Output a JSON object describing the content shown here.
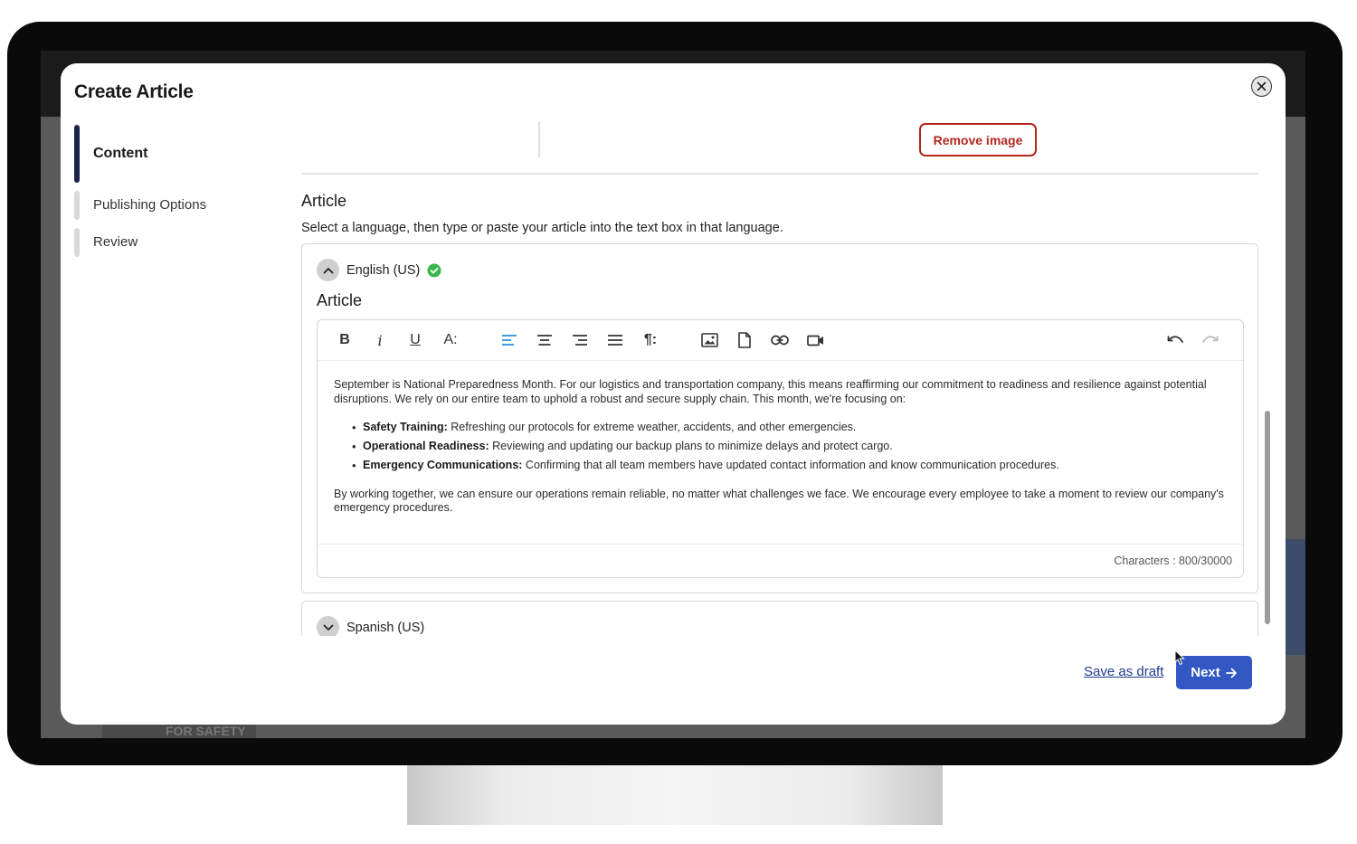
{
  "modal": {
    "title": "Create Article",
    "close_label": "×"
  },
  "stepper": {
    "items": [
      {
        "label": "Content",
        "active": true
      },
      {
        "label": "Publishing Options",
        "active": false
      },
      {
        "label": "Review",
        "active": false
      }
    ]
  },
  "image_section": {
    "remove_image_label": "Remove image"
  },
  "article_section": {
    "title": "Article",
    "subtitle": "Select a language, then type or paste your article into the text box in that language."
  },
  "languages": [
    {
      "label": "English (US)",
      "expanded": true,
      "complete": true
    },
    {
      "label": "Spanish (US)",
      "expanded": false,
      "complete": false
    }
  ],
  "editor": {
    "panel_title": "Article",
    "toolbar": {
      "bold": "B",
      "italic": "i",
      "underline": "U",
      "font_size": "A:",
      "paragraph": "¶:"
    },
    "intro": "September is National Preparedness Month. For our logistics and transportation company, this means reaffirming our commitment to readiness and resilience against potential disruptions. We rely on our entire team to uphold a robust and secure supply chain. This month, we're focusing on:",
    "bullets": [
      {
        "term": "Safety Training:",
        "text": " Refreshing our protocols for extreme weather, accidents, and other emergencies."
      },
      {
        "term": "Operational Readiness:",
        "text": " Reviewing and updating our backup plans to minimize delays and protect cargo."
      },
      {
        "term": "Emergency Communications:",
        "text": " Confirming that all team members have updated contact information and know communication procedures."
      }
    ],
    "closing": "By working together, we can ensure our operations remain reliable, no matter what challenges we face. We encourage every employee to take a moment to review our company's emergency procedures.",
    "char_count": "Characters : 800/30000"
  },
  "footer": {
    "save_draft_label": "Save as draft",
    "next_label": "Next"
  },
  "background": {
    "logo_text": "FOR SAFETY"
  },
  "colors": {
    "accent": "#3358c4",
    "danger": "#b3261e",
    "stepper_active": "#1b2451",
    "align_active": "#2a8be0",
    "success": "#3bb54a"
  }
}
